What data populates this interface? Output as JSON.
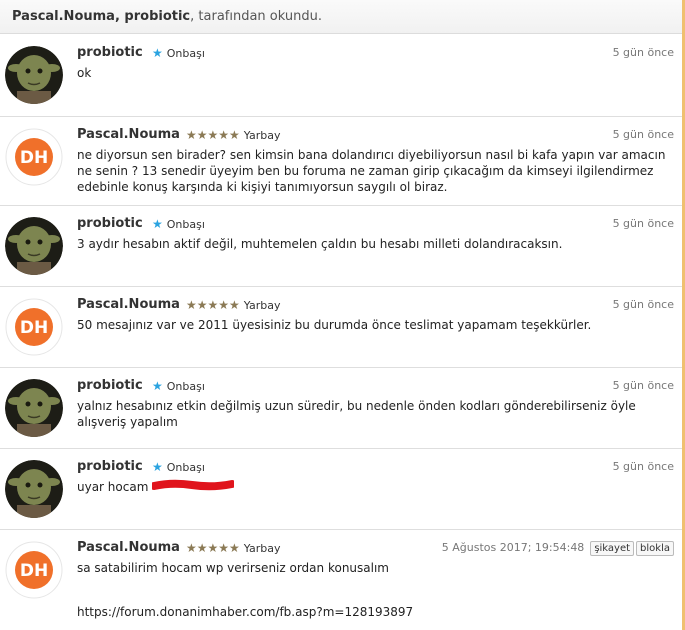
{
  "header": {
    "name1": "Pascal.Nouma",
    "sep": ", ",
    "name2": "probiotic",
    "rest": ", tarafından okundu."
  },
  "messages": [
    {
      "author": "probiotic",
      "rank": "Onbaşı",
      "rank_icon": "blue-star-icon",
      "date": "5 gün önce",
      "lines": [
        "ok"
      ]
    },
    {
      "author": "Pascal.Nouma",
      "rank": "Yarbay",
      "rank_icon": "five-stars-icon",
      "date": "5 gün önce",
      "lines": [
        "ne diyorsun sen birader? sen kimsin bana dolandırıcı diyebiliyorsun nasıl bi kafa yapın var amacın",
        "ne senin ? 13 senedir üyeyim ben bu foruma ne zaman girip çıkacağım da kimseyi ilgilendirmez",
        "edebinle konuş karşında ki kişiyi tanımıyorsun saygılı ol biraz."
      ]
    },
    {
      "author": "probiotic",
      "rank": "Onbaşı",
      "rank_icon": "blue-star-icon",
      "date": "5 gün önce",
      "lines": [
        "3 aydır hesabın aktif değil, muhtemelen çaldın bu hesabı milleti dolandıracaksın."
      ]
    },
    {
      "author": "Pascal.Nouma",
      "rank": "Yarbay",
      "rank_icon": "five-stars-icon",
      "date": "5 gün önce",
      "lines": [
        "50 mesajınız var ve 2011 üyesisiniz bu durumda önce teslimat yapamam teşekkürler."
      ]
    },
    {
      "author": "probiotic",
      "rank": "Onbaşı",
      "rank_icon": "blue-star-icon",
      "date": "5 gün önce",
      "lines": [
        "yalnız hesabınız etkin değilmiş uzun süredir, bu nedenle önden kodları gönderebilirseniz öyle",
        "alışveriş yapalım"
      ]
    },
    {
      "author": "probiotic",
      "rank": "Onbaşı",
      "rank_icon": "blue-star-icon",
      "date": "5 gün önce",
      "lines": [
        "uyar hocam"
      ]
    },
    {
      "author": "Pascal.Nouma",
      "rank": "Yarbay",
      "rank_icon": "five-stars-icon",
      "date": "5 Ağustos 2017; 19:54:48",
      "lines": [
        "sa satabilirim hocam wp verirseniz ordan konusalım"
      ],
      "link": "https://forum.donanimhaber.com/fb.asp?m=128193897",
      "buttons": [
        "şikayet",
        "blokla"
      ]
    }
  ],
  "colors": {
    "accent_blue": "#2aa3e0",
    "stars": "#8b7a55",
    "logo_orange": "#f0702a",
    "redaction": "#e0141c"
  }
}
